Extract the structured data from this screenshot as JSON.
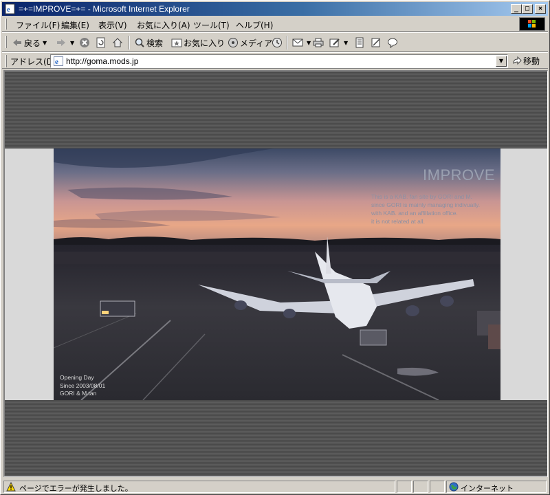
{
  "window": {
    "title": "=+=IMPROVE=+= - Microsoft Internet Explorer",
    "controls": {
      "minimize": "_",
      "maximize": "□",
      "close": "×"
    }
  },
  "menu": {
    "items": [
      {
        "label": "ファイル(F)"
      },
      {
        "label": "編集(E)"
      },
      {
        "label": "表示(V)"
      },
      {
        "label": "お気に入り(A)"
      },
      {
        "label": "ツール(T)"
      },
      {
        "label": "ヘルプ(H)"
      }
    ]
  },
  "toolbar": {
    "back_label": "戻る",
    "search_label": "検索",
    "favorites_label": "お気に入り",
    "media_label": "メディア"
  },
  "address": {
    "label": "アドレス(D)",
    "url": "http://goma.mods.jp",
    "go_label": "移動"
  },
  "page": {
    "site_title": "IMPROVE",
    "description_lines": [
      "This is a KAB. fan site by GORI and M.",
      "since GORI is mainly managing indivually.",
      "with KAB. and an affillation office.",
      "it is not related at all."
    ],
    "footer_lines": [
      "Opening Day",
      "Since 2003/08/01",
      "GORI & M.tan"
    ]
  },
  "status": {
    "message": "ページでエラーが発生しました。",
    "zone": "インターネット"
  }
}
